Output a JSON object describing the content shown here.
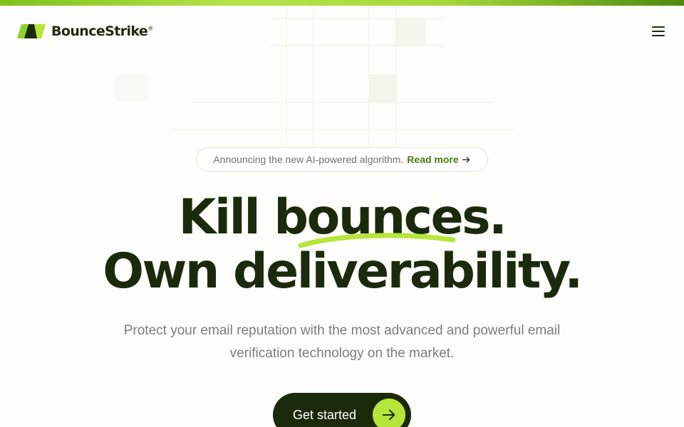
{
  "brand": {
    "name": "BounceStrike",
    "trademark": "®",
    "accent_color": "#b6e63a",
    "dark_color": "#1c2a0c",
    "link_color": "#4a7c0e"
  },
  "header": {
    "menu_icon": "hamburger-menu-icon"
  },
  "announcement": {
    "text": "Announcing the new AI-powered algorithm.",
    "link_label": "Read more",
    "link_icon": "arrow-right-icon"
  },
  "hero": {
    "headline_line1_a": "Kill ",
    "headline_line1_b": "bounces.",
    "headline_line2": "Own deliverability.",
    "subtext": "Protect your email reputation with the most advanced and powerful email verification technology on the market."
  },
  "cta": {
    "label": "Get started",
    "icon": "arrow-right-icon"
  }
}
